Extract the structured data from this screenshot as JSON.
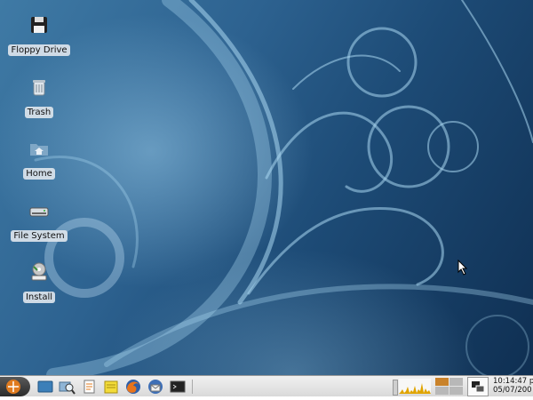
{
  "desktop": {
    "icons": [
      {
        "label": "Floppy Drive",
        "icon": "floppy-icon"
      },
      {
        "label": "Trash",
        "icon": "trash-icon"
      },
      {
        "label": "Home",
        "icon": "home-folder-icon"
      },
      {
        "label": "File System",
        "icon": "hard-drive-icon"
      },
      {
        "label": "Install",
        "icon": "install-icon"
      }
    ]
  },
  "panel": {
    "launchers": [
      {
        "icon": "show-desktop-icon"
      },
      {
        "icon": "file-search-icon"
      },
      {
        "icon": "text-editor-icon"
      },
      {
        "icon": "notes-icon"
      },
      {
        "icon": "firefox-icon"
      },
      {
        "icon": "thunderbird-icon"
      },
      {
        "icon": "terminal-icon"
      }
    ],
    "clock": {
      "time": "10:14:47 p",
      "date": "05/07/200"
    },
    "colors": {
      "panel": "#e6e6e6",
      "active_workspace": "#c9822a",
      "desktop_dark": "#0f2f52",
      "desktop_light": "#6aa6cf"
    }
  }
}
